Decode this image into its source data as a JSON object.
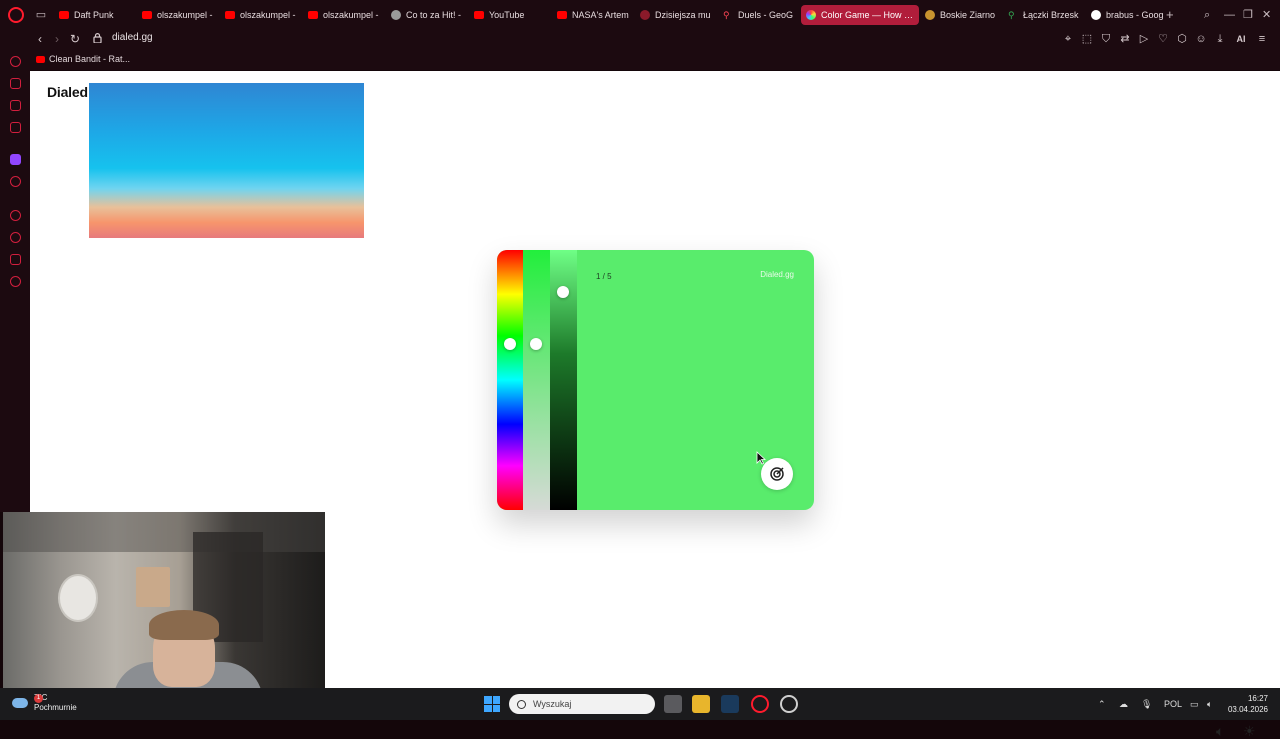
{
  "browser": {
    "tabs": [
      {
        "label": "Daft Punk",
        "icon": "youtube-icon",
        "active": false
      },
      {
        "label": "olszakumpel -",
        "icon": "youtube-icon",
        "active": false
      },
      {
        "label": "olszakumpel -",
        "icon": "youtube-icon",
        "active": false
      },
      {
        "label": "olszakumpel -",
        "icon": "youtube-icon",
        "active": false
      },
      {
        "label": "Co to za Hit! -",
        "icon": "globe-icon",
        "active": false
      },
      {
        "label": "YouTube",
        "icon": "youtube-icon",
        "active": false
      },
      {
        "label": "NASA's Artem",
        "icon": "youtube-icon",
        "active": false
      },
      {
        "label": "Dzisiejsza mu",
        "icon": "site-icon",
        "active": false
      },
      {
        "label": "Duels - GeoG",
        "icon": "geoguessr-icon",
        "active": false
      },
      {
        "label": "Color Game — How Well",
        "icon": "color-wheel-icon",
        "active": true
      },
      {
        "label": "Boskie Ziarno",
        "icon": "site-icon",
        "active": false
      },
      {
        "label": "Łączki Brzesk",
        "icon": "maps-pin-icon",
        "active": false
      },
      {
        "label": "brabus - Goog",
        "icon": "google-icon",
        "active": false
      }
    ],
    "url": "dialed.gg",
    "bookmarks": [
      {
        "label": "Clean Bandit - Rat...",
        "icon": "youtube-icon"
      }
    ],
    "toolbar_ai_label": "AI",
    "accent_color": "#b11d3b"
  },
  "page": {
    "site_title": "Dialed",
    "game": {
      "round": "1 / 5",
      "brand": "Dialed.gg",
      "current_color": "#59ec6c",
      "hue_level": 0.36,
      "saturation_level": 0.36,
      "lightness_level": 0.16
    }
  },
  "taskbar": {
    "weather_temp": "7°C",
    "weather_desc": "Pochmurnie",
    "weather_badge": "1",
    "search_placeholder": "Wyszukaj",
    "language": "POL",
    "time": "16:27",
    "date": "03.04.2026"
  }
}
